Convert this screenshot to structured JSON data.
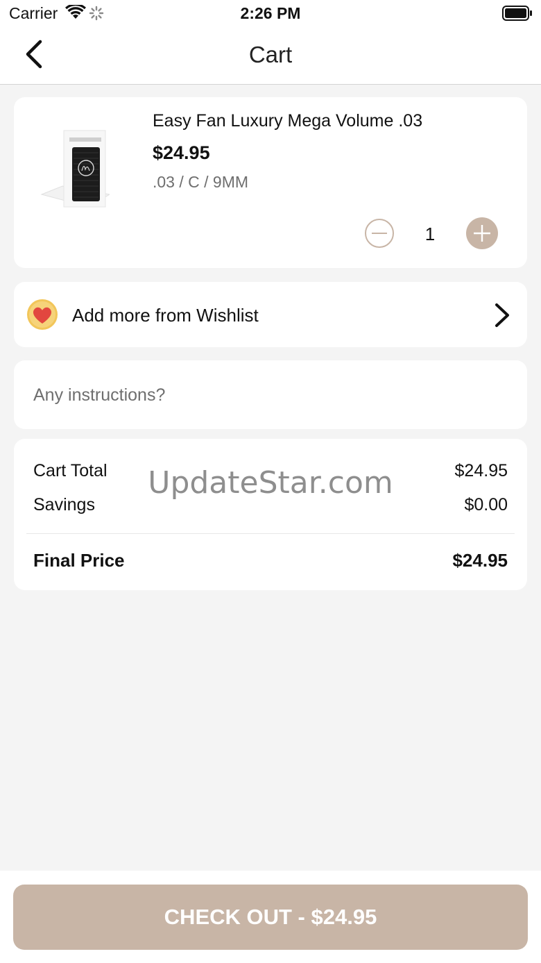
{
  "status_bar": {
    "carrier": "Carrier",
    "time": "2:26 PM",
    "icons": [
      "wifi-icon",
      "activity-spinner-icon",
      "battery-icon"
    ]
  },
  "nav": {
    "title": "Cart",
    "back_icon": "chevron-left-icon"
  },
  "cart_item": {
    "name": "Easy Fan Luxury Mega Volume .03",
    "price": "$24.95",
    "variant": ".03 / C / 9MM",
    "quantity": "1",
    "image_icon": "lash-tray-image"
  },
  "wishlist": {
    "label": "Add more from Wishlist",
    "icon": "heart-badge-icon"
  },
  "instructions": {
    "placeholder": "Any instructions?"
  },
  "summary": {
    "cart_total_label": "Cart Total",
    "cart_total_value": "$24.95",
    "savings_label": "Savings",
    "savings_value": "$0.00",
    "final_label": "Final Price",
    "final_value": "$24.95"
  },
  "watermark": "UpdateStar.com",
  "checkout": {
    "label": "CHECK OUT - $24.95"
  },
  "colors": {
    "accent": "#c8b5a6",
    "background": "#f4f4f4",
    "card": "#ffffff",
    "heart": "#e2473f",
    "heart_badge": "#f2c65a"
  }
}
